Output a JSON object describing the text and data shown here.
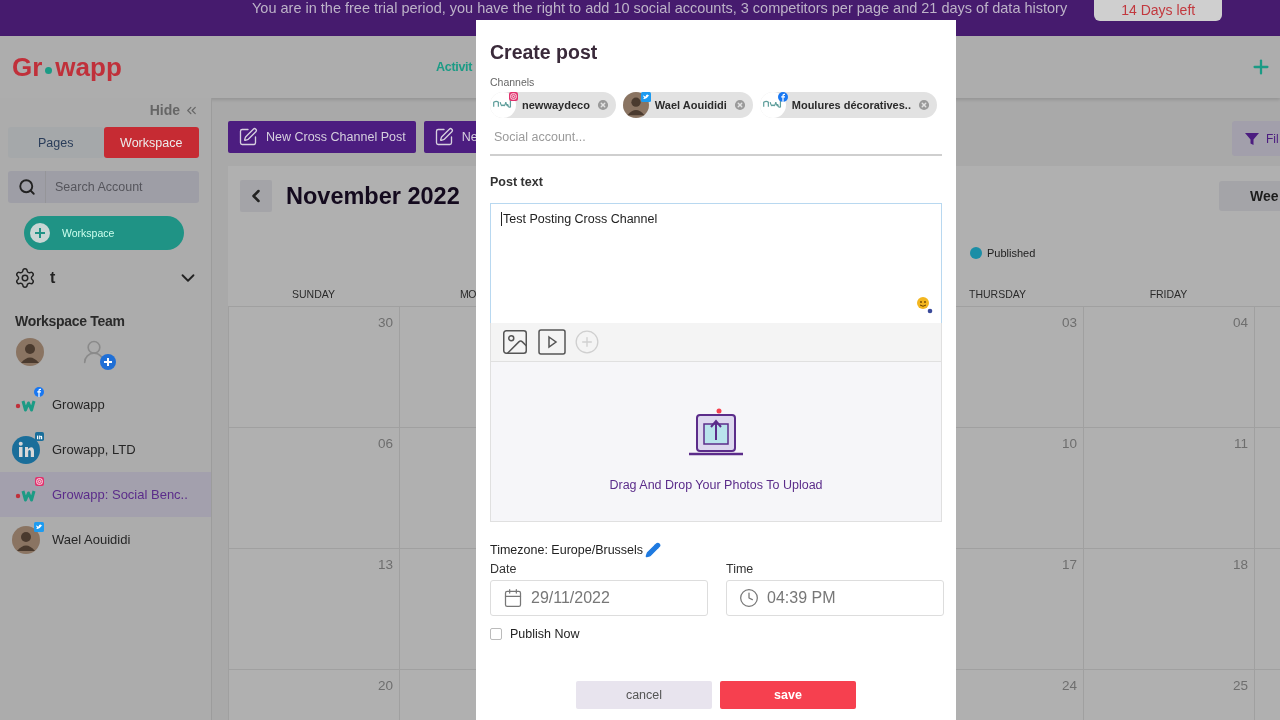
{
  "banner": {
    "message": "You are in the free trial period, you have the right to add 10 social accounts, 3 competitors per page and 21 days of data history",
    "trial_badge": "14 Days left"
  },
  "header": {
    "logo_start": "Gr",
    "logo_end": "wapp",
    "nav_link": "Activit"
  },
  "sidebar": {
    "hide_label": "Hide",
    "tabs": [
      {
        "label": "Pages",
        "selected": false
      },
      {
        "label": "Workspace",
        "selected": true
      }
    ],
    "search": {
      "placeholder": "Search Account"
    },
    "add_workspace": "Workspace",
    "workspace_name": "t",
    "team_title": "Workspace Team",
    "accounts": [
      {
        "name": "Growapp",
        "kind": "growapp",
        "badge": {
          "kind": "facebook"
        },
        "selected": false
      },
      {
        "name": "Growapp, LTD",
        "kind": "linkedin",
        "badge": {
          "kind": "linkedin"
        },
        "selected": false
      },
      {
        "name": "Growapp: Social Benc..",
        "kind": "growapp",
        "badge": {
          "kind": "instagram"
        },
        "selected": true
      },
      {
        "name": "Wael Aouididi",
        "kind": "person",
        "badge": {
          "kind": "twitter"
        },
        "selected": false
      }
    ]
  },
  "main": {
    "actions": [
      "New Cross Channel Post",
      "Ne"
    ],
    "filter": "Fil",
    "month": "November 2022",
    "view": "Wee",
    "legend": [
      {
        "label": "Published",
        "color": "#1b8ea6"
      }
    ],
    "day_headers": [
      {
        "label": "SUNDAY",
        "cut": false
      },
      {
        "label": "MO",
        "cut": true
      },
      {
        "label": "THURSDAY",
        "cut": false
      },
      {
        "label": "FRIDAY",
        "cut": false
      }
    ],
    "weeks": [
      [
        "30",
        "03",
        "04"
      ],
      [
        "06",
        "10",
        "11"
      ],
      [
        "13",
        "17",
        "18"
      ],
      [
        "20",
        "24",
        "25"
      ]
    ]
  },
  "modal": {
    "title": "Create post",
    "channels_label": "Channels",
    "channels": [
      {
        "name": "newwaydeco",
        "kind": "logo",
        "badge": {
          "kind": "instagram"
        }
      },
      {
        "name": "Wael Aouididi",
        "kind": "person",
        "badge": {
          "kind": "twitter"
        }
      },
      {
        "name": "Moulures décoratives..",
        "kind": "logo",
        "badge": {
          "kind": "facebook"
        }
      }
    ],
    "account_placeholder": "Social account...",
    "post_text_label": "Post text",
    "post_text": "Test Posting Cross Channel",
    "upload_hint": "Drag And Drop Your Photos To Upload",
    "timezone": "Timezone: Europe/Brussels",
    "date_label": "Date",
    "date": "29/11/2022",
    "time_label": "Time",
    "time": "04:39 PM",
    "publish_now": {
      "label": "Publish Now",
      "checked": false
    },
    "buttons": {
      "cancel": "cancel",
      "save": "save"
    }
  }
}
